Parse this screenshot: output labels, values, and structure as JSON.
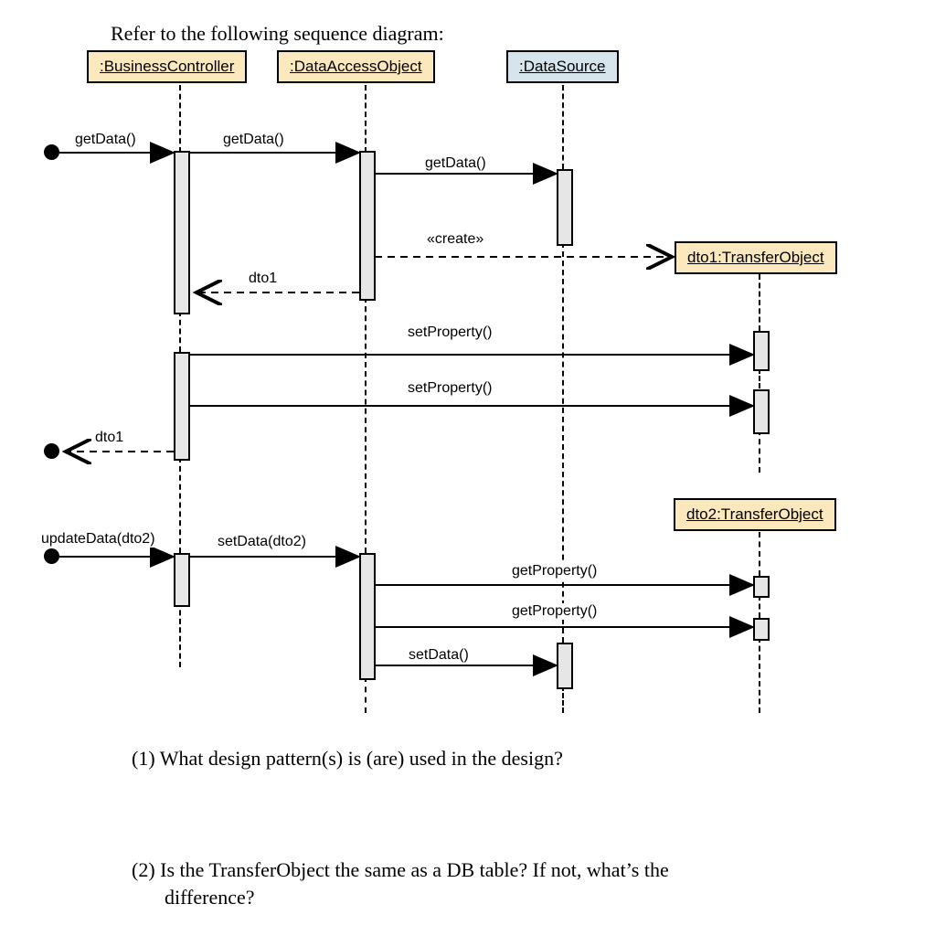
{
  "intro": "Refer to the following sequence diagram:",
  "participants": {
    "bc": ":BusinessController",
    "dao": ":DataAccessObject",
    "ds": ":DataSource",
    "dto1": "dto1:TransferObject",
    "dto2": "dto2:TransferObject"
  },
  "messages": {
    "getData1": "getData()",
    "getData2": "getData()",
    "getData3": "getData()",
    "create": "«create»",
    "dto1ret": "dto1",
    "setProp1": "setProperty()",
    "setProp2": "setProperty()",
    "dto1out": "dto1",
    "updateData": "updateData(dto2)",
    "setData": "setData(dto2)",
    "getProp1": "getProperty()",
    "getProp2": "getProperty()",
    "setData2": "setData()"
  },
  "questions": {
    "q1": "(1) What design pattern(s) is (are) used in the design?",
    "q2a": "(2) Is the TransferObject the same as a DB table? If not, what’s the",
    "q2b": "difference?"
  }
}
